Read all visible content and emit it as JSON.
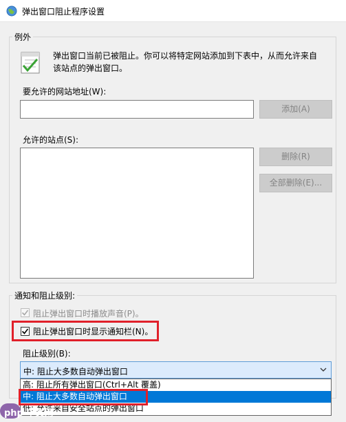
{
  "window": {
    "title": "弹出窗口阻止程序设置"
  },
  "exceptions": {
    "legend": "例外",
    "description_line1": "弹出窗口当前已被阻止。你可以将特定网站添加到下表中，从而允许来自",
    "description_line2": "该站点的弹出窗口。",
    "address_label": "要允许的网站地址(W):",
    "address_value": "",
    "add_button": "添加(A)",
    "allowed_label": "允许的站点(S):",
    "allowed_sites": [],
    "remove_button": "删除(R)",
    "remove_all_button": "全部删除(E)..."
  },
  "notifications": {
    "legend": "通知和阻止级别:",
    "play_sound_label": "阻止弹出窗口时播放声音(P)。",
    "play_sound_checked": true,
    "show_bar_label": "阻止弹出窗口时显示通知栏(N)。",
    "show_bar_checked": true,
    "level_label": "阻止级别(B):",
    "level_selected": "中: 阻止大多数自动弹出窗口",
    "level_options": [
      "高: 阻止所有弹出窗口(Ctrl+Alt 覆盖)",
      "中: 阻止大多数自动弹出窗口",
      "低: 允许来自安全站点的弹出窗口"
    ]
  },
  "watermark": "php 中文网",
  "colors": {
    "highlight_red": "#e0202a",
    "selection_blue": "#0078d7"
  },
  "icons": {
    "title": "globe-window-icon",
    "exceptions": "checklist-icon",
    "dropdown": "chevron-down-icon"
  }
}
